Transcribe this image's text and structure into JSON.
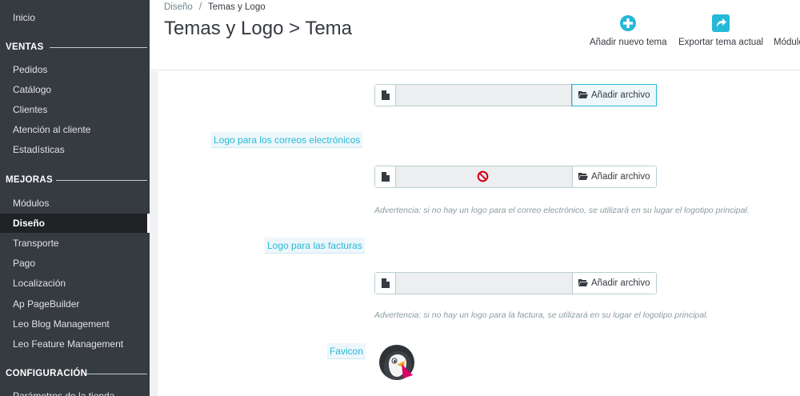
{
  "sidebar": {
    "top_item": "Inicio",
    "sections": [
      {
        "label": "VENTAS",
        "items": [
          "Pedidos",
          "Catálogo",
          "Clientes",
          "Atención al cliente",
          "Estadísticas"
        ]
      },
      {
        "label": "MEJORAS",
        "items": [
          "Módulos",
          "Diseño",
          "Transporte",
          "Pago",
          "Localización",
          "Ap PageBuilder",
          "Leo Blog Management",
          "Leo Feature Management"
        ]
      },
      {
        "label": "CONFIGURACIÓN",
        "items": [
          "Parámetros de la tienda"
        ]
      }
    ],
    "active_item": "Diseño"
  },
  "header": {
    "breadcrumb": [
      "Diseño",
      "Temas y Logo"
    ],
    "title": "Temas y Logo > Tema",
    "toolbar": [
      {
        "label": "Añadir nuevo tema",
        "icon": "plus-circle-icon"
      },
      {
        "label": "Exportar tema actual",
        "icon": "share-icon"
      },
      {
        "label": "Módulo",
        "icon": "module-icon"
      }
    ]
  },
  "form": {
    "add_file_label": "Añadir archivo",
    "email_logo_label": "Logo para los correos electrónicos",
    "email_logo_hint": "Advertencia: si no hay un logo para el correo electrónico, se utilizará en su lugar el logotipo principal.",
    "invoice_logo_label": "Logo para las facturas",
    "invoice_logo_hint": "Advertencia: si no hay un logo para la factura, se utilizará en su lugar el logotipo principal.",
    "favicon_label": "Favicon"
  },
  "colors": {
    "sidebar_bg": "#363a41",
    "accent": "#25b9d7",
    "forbidden": "#d0021b"
  }
}
